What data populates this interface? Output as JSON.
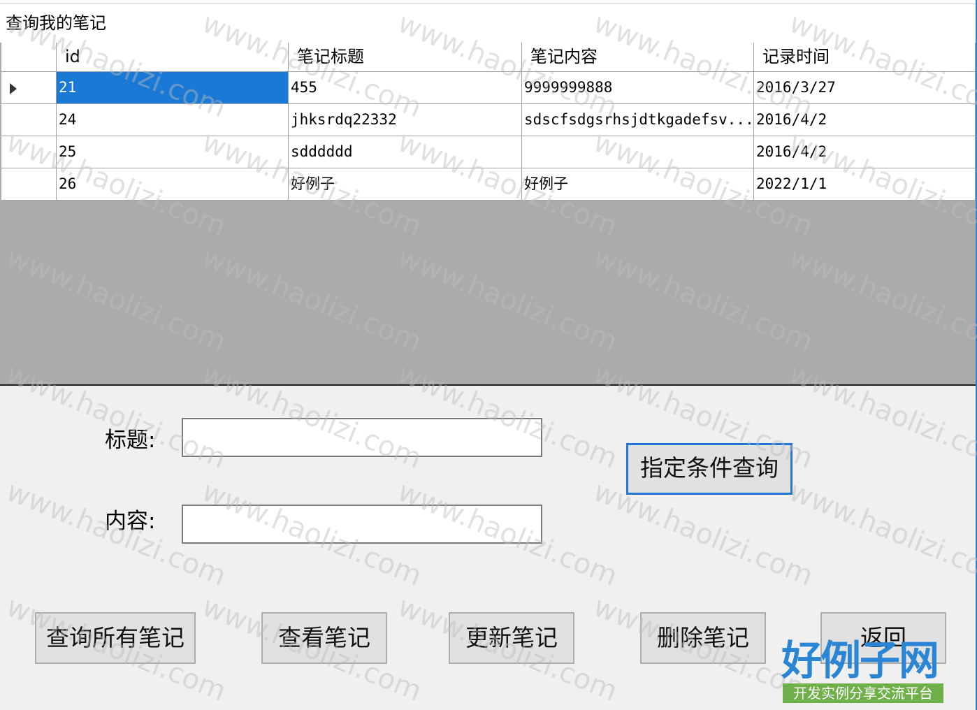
{
  "group": {
    "title": "查询我的笔记"
  },
  "grid": {
    "columns": [
      "id",
      "笔记标题",
      "笔记内容",
      "记录时间"
    ],
    "rows": [
      [
        "21",
        "455",
        "9999999888",
        "2016/3/27"
      ],
      [
        "24",
        "jhksrdq22332",
        "sdscfsdgsrhsjdtkgadefsv...",
        "2016/4/2"
      ],
      [
        "25",
        "sdddddd",
        "",
        "2016/4/2"
      ],
      [
        "26",
        "好例子",
        "好例子",
        "2022/1/1"
      ]
    ],
    "selected_row": 0
  },
  "form": {
    "title_label": "标题:",
    "content_label": "内容:",
    "title_value": "",
    "content_value": "",
    "query_button": "指定条件查询"
  },
  "buttons": {
    "query_all": "查询所有笔记",
    "view": "查看笔记",
    "update": "更新笔记",
    "delete": "删除笔记",
    "back": "返回"
  },
  "watermark": {
    "text": "www.haolizi.com"
  },
  "logo": {
    "main": "好例子网",
    "sub": "开发实例分享交流平台"
  },
  "colors": {
    "selection": "#1a78d6",
    "focus_border": "#2476d6",
    "logo_blue": "#2a86d4",
    "logo_green": "#6fb04a"
  }
}
